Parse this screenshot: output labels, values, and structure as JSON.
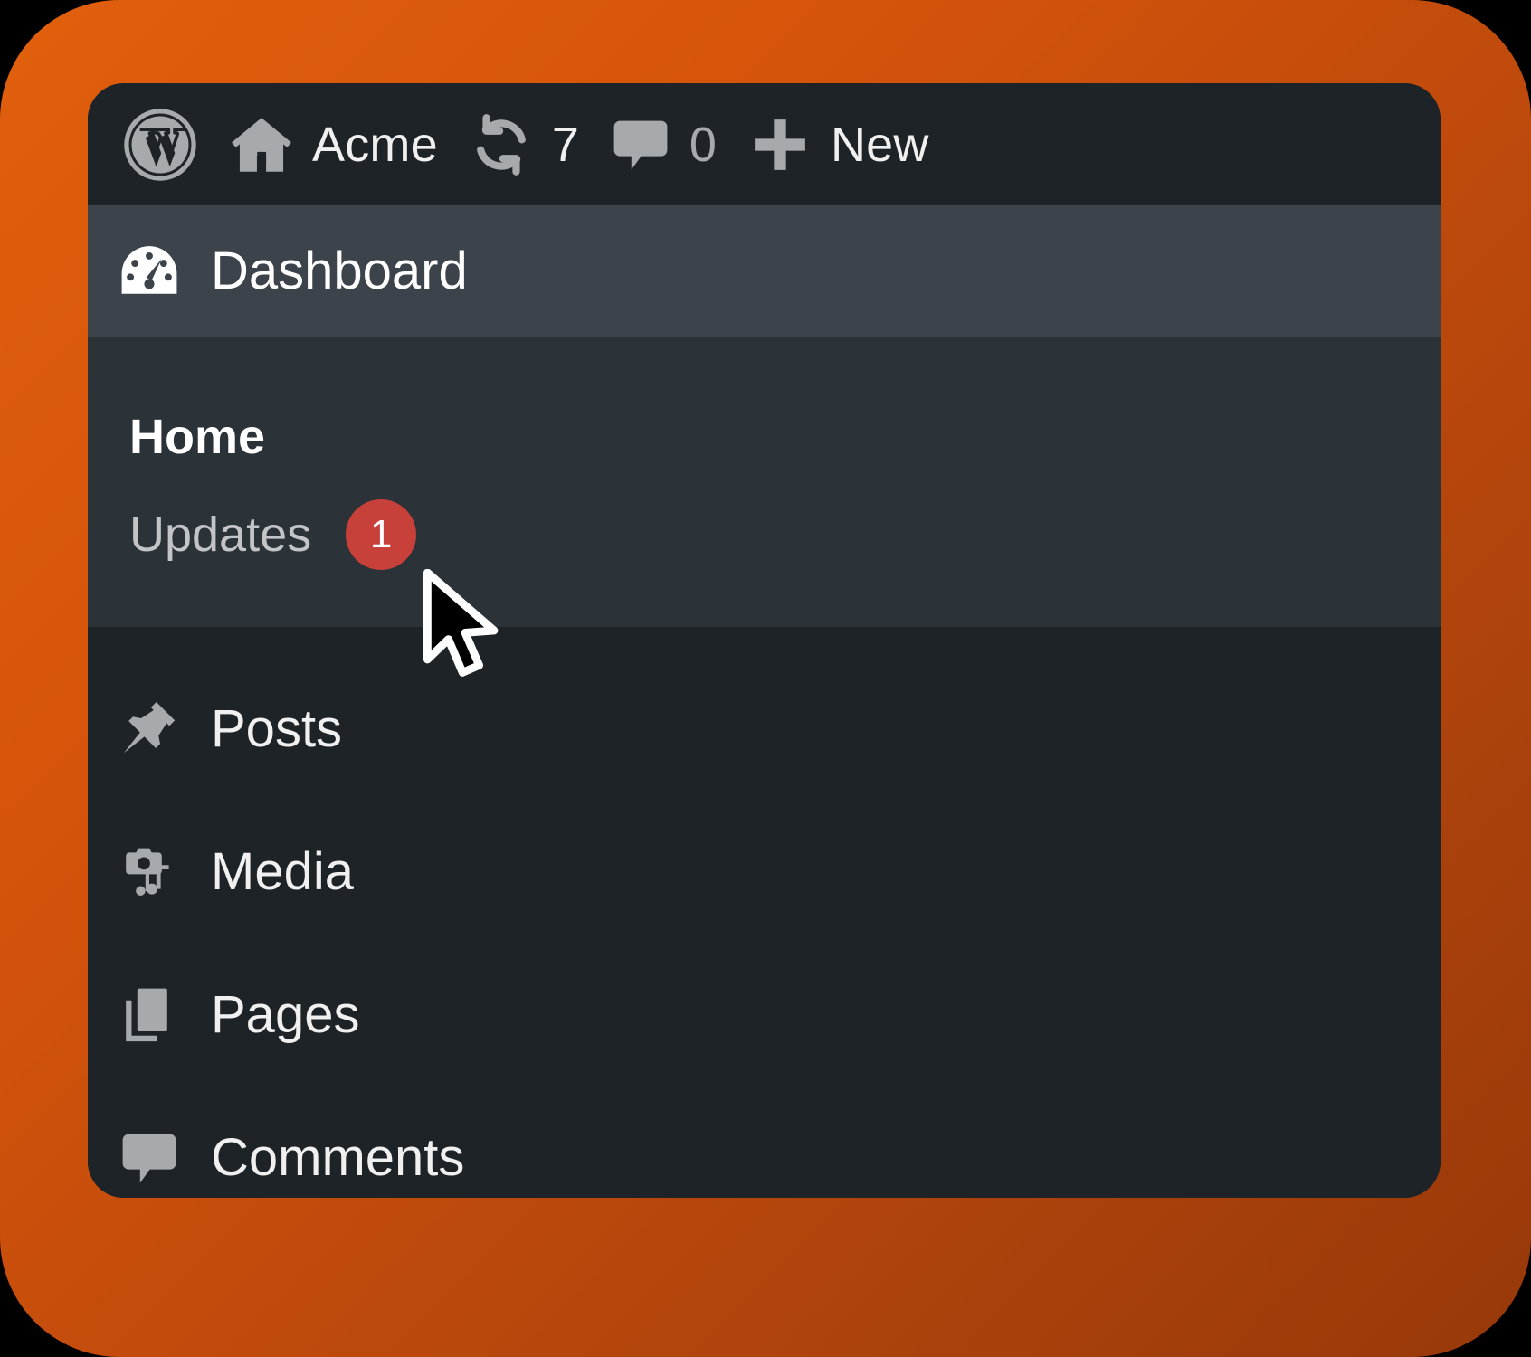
{
  "theme": {
    "backdrop_start": "#e0600d",
    "backdrop_end": "#97380a",
    "panel_bg": "#1d2327",
    "active_bg": "#3c434a",
    "submenu_bg": "#2c3338",
    "icon_gray": "#a7aaad",
    "text_light": "#f0f0f1",
    "badge_red": "#c8403a"
  },
  "admin_bar": {
    "logo": {
      "icon": "wordpress-logo-icon"
    },
    "site": {
      "icon": "home-icon",
      "label": "Acme"
    },
    "updates": {
      "icon": "update-sync-icon",
      "count": "7"
    },
    "comments": {
      "icon": "comment-bubble-icon",
      "count": "0"
    },
    "new": {
      "icon": "plus-icon",
      "label": "New"
    }
  },
  "menu": {
    "dashboard": {
      "icon": "dashboard-gauge-icon",
      "label": "Dashboard",
      "active": true,
      "submenu": [
        {
          "label": "Home",
          "current": true
        },
        {
          "label": "Updates",
          "current": false,
          "badge": "1"
        }
      ]
    },
    "items": [
      {
        "icon": "pushpin-icon",
        "label": "Posts"
      },
      {
        "icon": "camera-music-icon",
        "label": "Media"
      },
      {
        "icon": "pages-stack-icon",
        "label": "Pages"
      },
      {
        "icon": "comment-bubble-icon",
        "label": "Comments"
      }
    ]
  },
  "cursor": {
    "icon": "mouse-arrow-cursor"
  }
}
